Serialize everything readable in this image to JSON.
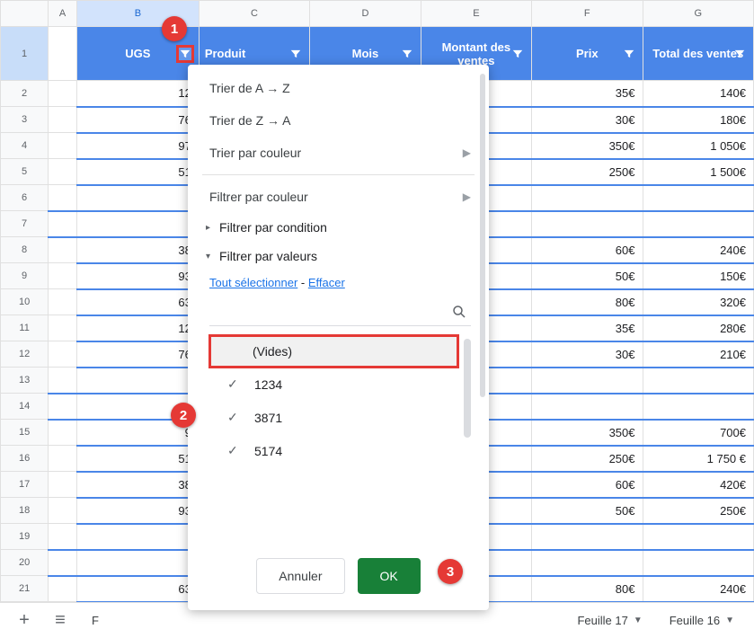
{
  "columns": {
    "A": "A",
    "B": "B",
    "C": "C",
    "D": "D",
    "E": "E",
    "F": "F",
    "G": "G"
  },
  "row_numbers": [
    "1",
    "2",
    "3",
    "4",
    "5",
    "6",
    "7",
    "8",
    "9",
    "10",
    "11",
    "12",
    "13",
    "14",
    "15",
    "16",
    "17",
    "18",
    "19",
    "20",
    "21"
  ],
  "headers": {
    "B": "UGS",
    "C": "Produit",
    "D": "Mois",
    "E": "Montant des ventes",
    "F": "Prix",
    "G": "Total des ventes"
  },
  "rows": [
    {
      "b": "12",
      "f": "35€",
      "g": "140€"
    },
    {
      "b": "76",
      "f": "30€",
      "g": "180€"
    },
    {
      "b": "97",
      "f": "350€",
      "g": "1 050€"
    },
    {
      "b": "51",
      "f": "250€",
      "g": "1 500€"
    },
    {
      "b": "",
      "f": "",
      "g": ""
    },
    {
      "b": "",
      "f": "",
      "g": ""
    },
    {
      "b": "38",
      "f": "60€",
      "g": "240€"
    },
    {
      "b": "93",
      "f": "50€",
      "g": "150€"
    },
    {
      "b": "63",
      "f": "80€",
      "g": "320€"
    },
    {
      "b": "12",
      "f": "35€",
      "g": "280€"
    },
    {
      "b": "76",
      "f": "30€",
      "g": "210€"
    },
    {
      "b": "",
      "f": "",
      "g": ""
    },
    {
      "b": "",
      "f": "",
      "g": ""
    },
    {
      "b": "9",
      "f": "350€",
      "g": "700€"
    },
    {
      "b": "51",
      "f": "250€",
      "g": "1 750 €"
    },
    {
      "b": "38",
      "f": "60€",
      "g": "420€"
    },
    {
      "b": "93",
      "f": "50€",
      "g": "250€"
    },
    {
      "b": "",
      "f": "",
      "g": ""
    },
    {
      "b": "",
      "f": "",
      "g": ""
    },
    {
      "b": "63",
      "f": "80€",
      "g": "240€"
    }
  ],
  "filter_panel": {
    "sort_az": "Trier de A → Z",
    "sort_za": "Trier de Z → A",
    "sort_color": "Trier par couleur",
    "filter_color": "Filtrer par couleur",
    "filter_condition": "Filtrer par condition",
    "filter_values": "Filtrer par valeurs",
    "select_all": "Tout sélectionner",
    "clear": "Effacer",
    "separator": " - ",
    "search_placeholder": "",
    "values": {
      "blanks": "(Vides)",
      "v1": "1234",
      "v2": "3871",
      "v3": "5174"
    },
    "cancel": "Annuler",
    "ok": "OK"
  },
  "callouts": {
    "c1": "1",
    "c2": "2",
    "c3": "3"
  },
  "tabs": {
    "current_partial": "F",
    "t17": "Feuille 17",
    "t16": "Feuille 16"
  }
}
